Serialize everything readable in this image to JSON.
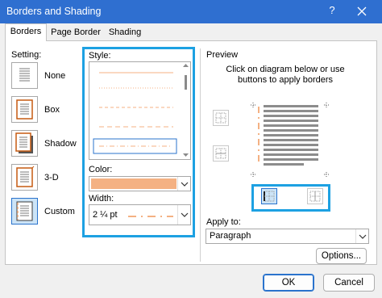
{
  "window": {
    "title": "Borders and Shading",
    "help_glyph": "?"
  },
  "tabs": [
    {
      "label": "Borders",
      "active": true
    },
    {
      "label": "Page Border",
      "active": false
    },
    {
      "label": "Shading",
      "active": false
    }
  ],
  "setting": {
    "label": "Setting:",
    "options": [
      {
        "label": "None",
        "selected": false
      },
      {
        "label": "Box",
        "selected": false
      },
      {
        "label": "Shadow",
        "selected": false
      },
      {
        "label": "3-D",
        "selected": false
      },
      {
        "label": "Custom",
        "selected": true
      }
    ]
  },
  "style": {
    "label": "Style:",
    "selected_index": 4
  },
  "color": {
    "label": "Color:",
    "value_swatch": "#f4b183"
  },
  "width": {
    "label": "Width:",
    "value": "2 ¼ pt"
  },
  "preview": {
    "label": "Preview",
    "instructions": "Click on diagram below or use buttons to apply borders"
  },
  "apply_to": {
    "label": "Apply to:",
    "value": "Paragraph"
  },
  "buttons": {
    "options": "Options...",
    "ok": "OK",
    "cancel": "Cancel"
  },
  "colors": {
    "titlebar": "#2f6fd0",
    "accent_border": "#f4b183",
    "highlight": "#1da1e2"
  }
}
